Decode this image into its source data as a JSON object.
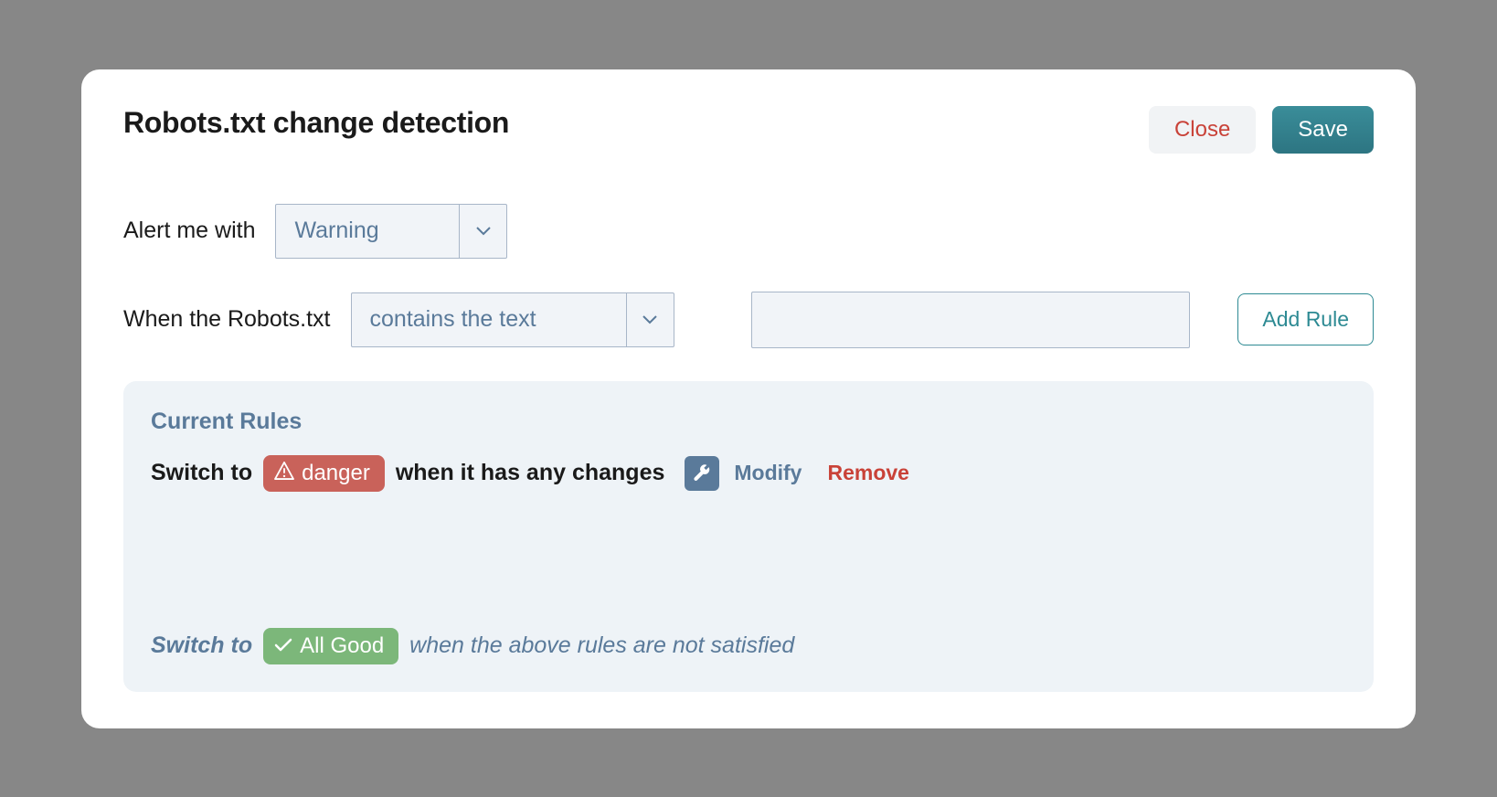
{
  "modal": {
    "title": "Robots.txt change detection",
    "close_label": "Close",
    "save_label": "Save"
  },
  "form": {
    "alert_label": "Alert me with",
    "alert_value": "Warning",
    "when_label": "When the Robots.txt",
    "condition_value": "contains the text",
    "text_value": "",
    "text_placeholder": "",
    "add_rule_label": "Add Rule"
  },
  "rules": {
    "heading": "Current Rules",
    "items": [
      {
        "prefix": "Switch to",
        "badge_level": "danger",
        "badge_text": "danger",
        "suffix": "when it has any changes",
        "modify_label": "Modify",
        "remove_label": "Remove"
      }
    ],
    "fallback": {
      "prefix": "Switch to",
      "badge_text": "All Good",
      "suffix": "when the above rules are not satisfied"
    }
  }
}
